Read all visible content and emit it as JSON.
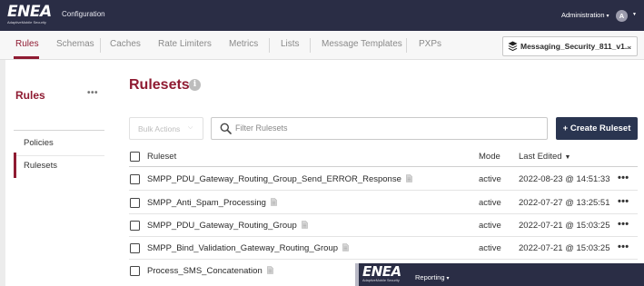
{
  "header": {
    "logo_text": "ENEA",
    "logo_subtext": "AdaptiveMobile Security",
    "app_section": "Configuration",
    "admin_label": "Administration",
    "user_initial": "A"
  },
  "nav": {
    "tabs": [
      "Rules",
      "Schemas",
      "Caches",
      "Rate Limiters",
      "Metrics",
      "Lists",
      "Message Templates",
      "PXPs"
    ],
    "active_tab": "Rules",
    "workspace": "Messaging_Security_811_v1..."
  },
  "sidebar": {
    "title": "Rules",
    "items": [
      "Policies",
      "Rulesets"
    ],
    "active_item": "Rulesets"
  },
  "main": {
    "title": "Rulesets",
    "bulk_actions_label": "Bulk Actions",
    "filter_placeholder": "Filter Rulesets",
    "create_label": "+ Create Ruleset"
  },
  "table": {
    "columns": [
      "Ruleset",
      "Mode",
      "Last Edited"
    ],
    "rows": [
      {
        "name": "SMPP_PDU_Gateway_Routing_Group_Send_ERROR_Response",
        "mode": "active",
        "last_edited": "2022-08-23 @ 14:51:33"
      },
      {
        "name": "SMPP_Anti_Spam_Processing",
        "mode": "active",
        "last_edited": "2022-07-27 @ 13:25:51"
      },
      {
        "name": "SMPP_PDU_Gateway_Routing_Group",
        "mode": "active",
        "last_edited": "2022-07-21 @ 15:03:25"
      },
      {
        "name": "SMPP_Bind_Validation_Gateway_Routing_Group",
        "mode": "active",
        "last_edited": "2022-07-21 @ 15:03:25"
      },
      {
        "name": "Process_SMS_Concatenation",
        "mode": "",
        "last_edited": ""
      }
    ]
  },
  "overlay_window": {
    "logo_text": "ENEA",
    "logo_subtext": "AdaptiveMobile Security",
    "menu_label": "Reporting"
  },
  "colors": {
    "brand_dark": "#2a2d45",
    "accent": "#8f1b32",
    "button_dark": "#2a3550"
  }
}
